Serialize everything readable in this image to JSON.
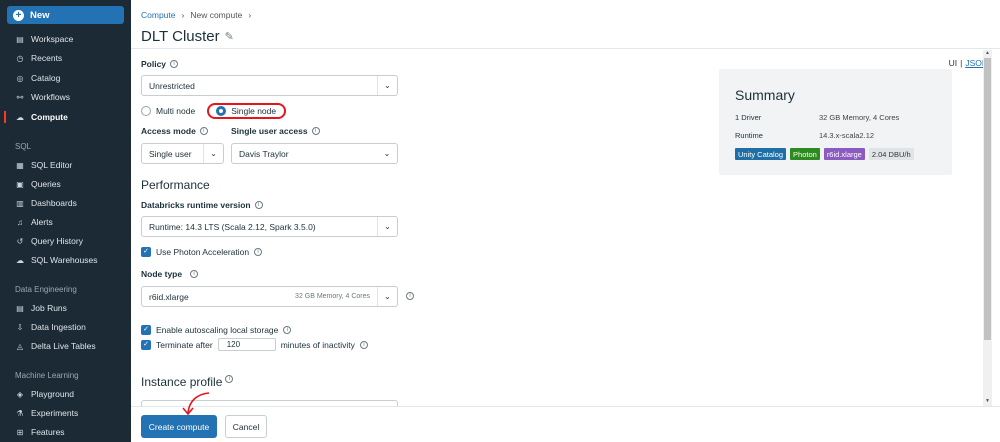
{
  "sidebar": {
    "new_label": "New",
    "items": [
      {
        "label": "Workspace",
        "icon": "workspace-icon",
        "glyph": "▤"
      },
      {
        "label": "Recents",
        "icon": "clock-icon",
        "glyph": "◷"
      },
      {
        "label": "Catalog",
        "icon": "catalog-icon",
        "glyph": "◎"
      },
      {
        "label": "Workflows",
        "icon": "workflows-icon",
        "glyph": "⚯"
      },
      {
        "label": "Compute",
        "icon": "cloud-icon",
        "glyph": "☁"
      }
    ],
    "sql_section": "SQL",
    "sql_items": [
      {
        "label": "SQL Editor",
        "icon": "sql-editor-icon",
        "glyph": "▦"
      },
      {
        "label": "Queries",
        "icon": "queries-icon",
        "glyph": "▣"
      },
      {
        "label": "Dashboards",
        "icon": "dashboards-icon",
        "glyph": "▥"
      },
      {
        "label": "Alerts",
        "icon": "bell-icon",
        "glyph": "♫"
      },
      {
        "label": "Query History",
        "icon": "history-icon",
        "glyph": "↺"
      },
      {
        "label": "SQL Warehouses",
        "icon": "warehouse-icon",
        "glyph": "☁"
      }
    ],
    "de_section": "Data Engineering",
    "de_items": [
      {
        "label": "Job Runs",
        "icon": "job-runs-icon",
        "glyph": "▤"
      },
      {
        "label": "Data Ingestion",
        "icon": "ingestion-icon",
        "glyph": "⇩"
      },
      {
        "label": "Delta Live Tables",
        "icon": "delta-icon",
        "glyph": "◬"
      }
    ],
    "ml_section": "Machine Learning",
    "ml_items": [
      {
        "label": "Playground",
        "icon": "playground-icon",
        "glyph": "◈"
      },
      {
        "label": "Experiments",
        "icon": "flask-icon",
        "glyph": "⚗"
      },
      {
        "label": "Features",
        "icon": "features-icon",
        "glyph": "⊞"
      }
    ]
  },
  "breadcrumb": {
    "root": "Compute",
    "current": "New compute",
    "sep": "›"
  },
  "title": "DLT Cluster",
  "view_toggle": {
    "ui": "UI",
    "sep": "|",
    "json": "JSON"
  },
  "policy": {
    "label": "Policy",
    "value": "Unrestricted"
  },
  "node_mode": {
    "multi": "Multi node",
    "single": "Single node",
    "selected": "single"
  },
  "access_mode": {
    "label": "Access mode",
    "value": "Single user"
  },
  "single_user": {
    "label": "Single user access",
    "value": "Davis Traylor"
  },
  "performance": {
    "title": "Performance",
    "runtime_label": "Databricks runtime version",
    "runtime_value": "Runtime: 14.3 LTS (Scala 2.12, Spark 3.5.0)",
    "photon_label": "Use Photon Acceleration",
    "node_type_label": "Node type",
    "node_type_value": "r6id.xlarge",
    "node_type_meta": "32 GB Memory, 4 Cores",
    "autoscale_label": "Enable autoscaling local storage",
    "terminate_prefix": "Terminate after",
    "terminate_value": "120",
    "terminate_suffix": "minutes of inactivity"
  },
  "instance_profile": {
    "title": "Instance profile"
  },
  "summary": {
    "title": "Summary",
    "driver_label": "1 Driver",
    "driver_value": "32 GB Memory, 4 Cores",
    "runtime_label": "Runtime",
    "runtime_value": "14.3.x-scala2.12",
    "tags": [
      {
        "label": "Unity Catalog",
        "color": "#1f6fa6"
      },
      {
        "label": "Photon",
        "color": "#2e8a1f"
      },
      {
        "label": "r6id.xlarge",
        "color": "#8b5bc2"
      }
    ],
    "dbu": "2.04 DBU/h"
  },
  "actions": {
    "create": "Create compute",
    "cancel": "Cancel"
  },
  "colors": {
    "accent": "#2272b4",
    "highlight": "#e8141b",
    "sidebar": "#1b2a35"
  }
}
